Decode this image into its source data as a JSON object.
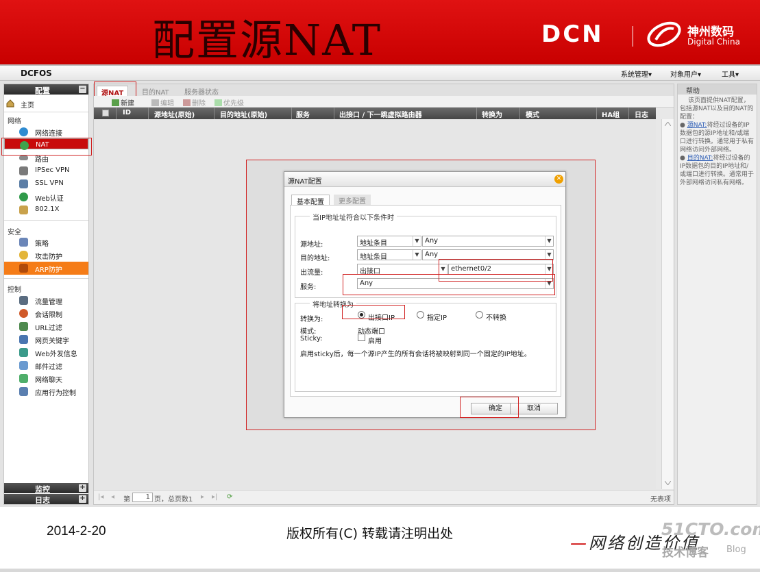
{
  "banner": {
    "title": "配置源NAT",
    "logo_dcn": "DCN",
    "logo_cn": "神州数码",
    "logo_en": "Digital China"
  },
  "topbar": {
    "brand": "DCFOS",
    "menu": [
      "系统管理▾",
      "对象用户▾",
      "工具▾"
    ]
  },
  "sidebar": {
    "config_header": "配置",
    "home": "主页",
    "sections": {
      "network": "网络",
      "security": "安全",
      "control": "控制"
    },
    "network_items": [
      "网络连接",
      "NAT",
      "路由",
      "IPSec VPN",
      "SSL VPN",
      "Web认证",
      "802.1X"
    ],
    "security_items": [
      "策略",
      "攻击防护",
      "ARP防护"
    ],
    "control_items": [
      "流量管理",
      "会话限制",
      "URL过滤",
      "网页关键字",
      "Web外发信息",
      "邮件过滤",
      "网络聊天",
      "应用行为控制"
    ],
    "monitor_header": "监控",
    "log_header": "日志",
    "collapse_symbol": "−",
    "expand_symbol": "+"
  },
  "main": {
    "tabs": [
      "源NAT",
      "目的NAT",
      "服务器状态"
    ],
    "toolbar": [
      "新建",
      "编辑",
      "删除",
      "优先级"
    ],
    "columns": [
      "ID",
      "源地址(原始)",
      "目的地址(原始)",
      "服务",
      "出接口 / 下一跳虚拟路由器",
      "转换为",
      "模式",
      "HA组",
      "日志"
    ],
    "pager": {
      "page_prefix": "第",
      "page_value": "1",
      "page_suffix": "页，总页数1",
      "no_items": "无表项"
    }
  },
  "help": {
    "header": "帮助",
    "intro": "该页面提供NAT配置，包括源NAT以及目的NAT的配置：",
    "item1_link": "源NAT:",
    "item1_text": "将经过设备的IP数据包的源IP地址和/或端口进行转换。通常用于私有网络访问外部网络。",
    "item2_link": "目的NAT:",
    "item2_text": "将经过设备的IP数据包的目的IP地址和/或端口进行转换。通常用于外部网络访问私有网络。"
  },
  "dialog": {
    "title": "源NAT配置",
    "close": "✕",
    "tab_basic": "基本配置",
    "tab_more": "更多配置",
    "group1_legend": "当IP地址址符合以下条件时",
    "src_label": "源地址:",
    "src_type": "地址条目",
    "src_value": "Any",
    "dst_label": "目的地址:",
    "dst_type": "地址条目",
    "dst_value": "Any",
    "egress_label": "出流量:",
    "egress_type": "出接口",
    "egress_value": "ethernet0/2",
    "service_label": "服务:",
    "service_value": "Any",
    "group2_legend": "将地址转换为",
    "translate_label": "转换为:",
    "opt_egress_ip": "出接口IP",
    "opt_specified_ip": "指定IP",
    "opt_no_translate": "不转换",
    "mode_label": "模式:",
    "mode_value": "动态端口",
    "sticky_label": "Sticky:",
    "sticky_option": "启用",
    "note": "启用sticky后，每一个源IP产生的所有会话将被映射到同一个固定的IP地址。",
    "ok": "确定",
    "cancel": "取消"
  },
  "footer": {
    "date": "2014-2-20",
    "copyright": "版权所有(C) 转载请注明出处",
    "slogan_dash": "—",
    "slogan": "网络创造价值",
    "watermark_site": "51CTO.com",
    "watermark_tech": "技术博客",
    "watermark_blog": "Blog"
  },
  "colors": {
    "brand_red": "#c80000",
    "selected_nav": "#c80a0a",
    "arp_orange": "#f57c17",
    "highlight_box": "#d02020"
  }
}
